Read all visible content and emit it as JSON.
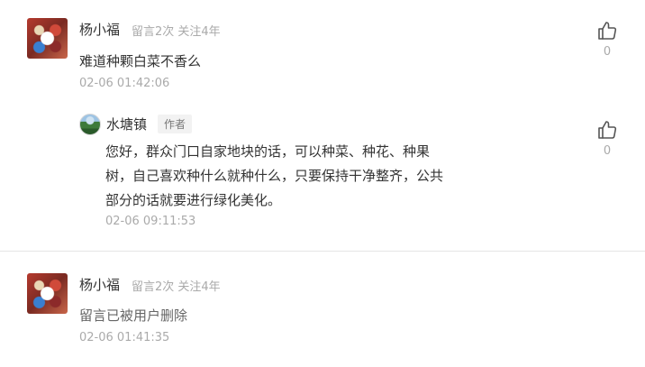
{
  "comments": [
    {
      "username": "杨小福",
      "meta": "留言2次 关注4年",
      "text": "难道种颗白菜不香么",
      "time": "02-06 01:42:06",
      "likes": "0",
      "reply": {
        "username": "水塘镇",
        "badge": "作者",
        "text_lines": [
          "您好，群众门口自家地块的话，可以种菜、种花、种果",
          "树，自己喜欢种什么就种什么，只要保持干净整齐，公共",
          "部分的话就要进行绿化美化。"
        ],
        "time": "02-06 09:11:53",
        "likes": "0"
      }
    },
    {
      "username": "杨小福",
      "meta": "留言2次 关注4年",
      "text": "留言已被用户删除",
      "time": "02-06 01:41:35"
    }
  ],
  "icons": {
    "like": "thumbs-up-icon"
  }
}
